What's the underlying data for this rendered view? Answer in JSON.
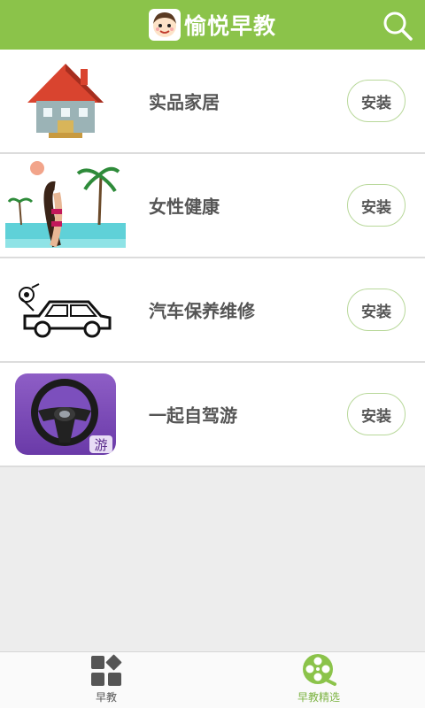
{
  "header": {
    "title": "愉悦早教",
    "logo_icon": "girl-avatar-icon",
    "search_icon": "search-icon",
    "accent_color": "#8bc34a"
  },
  "apps": [
    {
      "name": "实品家居",
      "icon": "house-icon",
      "button": "安装"
    },
    {
      "name": "女性健康",
      "icon": "beach-woman-icon",
      "button": "安装"
    },
    {
      "name": "汽车保养维修",
      "icon": "car-icon",
      "button": "安装"
    },
    {
      "name": "一起自驾游",
      "icon": "steering-wheel-icon",
      "button": "安装",
      "badge": "游"
    }
  ],
  "tabbar": {
    "tabs": [
      {
        "label": "早教",
        "icon": "grid-icon",
        "active": false
      },
      {
        "label": "早教精选",
        "icon": "film-reel-icon",
        "active": true
      }
    ]
  }
}
